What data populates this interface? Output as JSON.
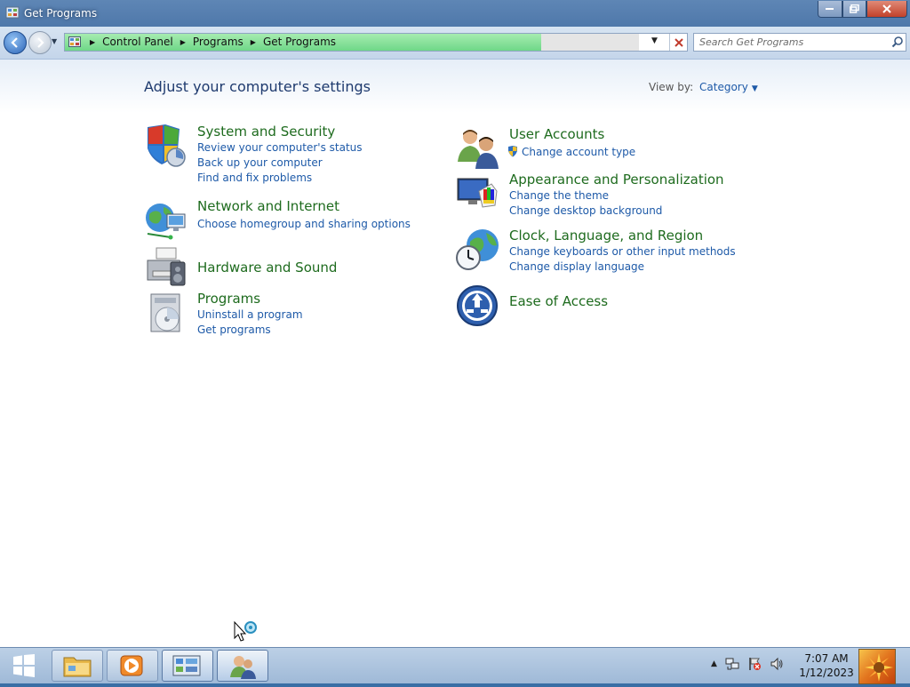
{
  "window": {
    "title": "Get Programs"
  },
  "navigation": {
    "breadcrumbs": [
      "Control Panel",
      "Programs",
      "Get Programs"
    ],
    "search_placeholder": "Search Get Programs"
  },
  "content": {
    "heading": "Adjust your computer's settings",
    "view_by_label": "View by:",
    "view_by_value": "Category",
    "categories_left": [
      {
        "title": "System and Security",
        "icon": "shield-icon",
        "links": [
          "Review your computer's status",
          "Back up your computer",
          "Find and fix problems"
        ]
      },
      {
        "title": "Network and Internet",
        "icon": "globe-network-icon",
        "links": [
          "Choose homegroup and sharing options"
        ]
      },
      {
        "title": "Hardware and Sound",
        "icon": "printer-speaker-icon",
        "links": []
      },
      {
        "title": "Programs",
        "icon": "programs-disc-icon",
        "links": [
          "Uninstall a program",
          "Get programs"
        ]
      }
    ],
    "categories_right": [
      {
        "title": "User Accounts",
        "icon": "users-icon",
        "links": [
          "Change account type"
        ]
      },
      {
        "title": "Appearance and Personalization",
        "icon": "monitor-palette-icon",
        "links": [
          "Change the theme",
          "Change desktop background"
        ]
      },
      {
        "title": "Clock, Language, and Region",
        "icon": "clock-globe-icon",
        "links": [
          "Change keyboards or other input methods",
          "Change display language"
        ]
      },
      {
        "title": "Ease of Access",
        "icon": "ease-of-access-icon",
        "links": []
      }
    ]
  },
  "taskbar": {
    "time": "7:07 AM",
    "date": "1/12/2023",
    "pinned": [
      "file-explorer-icon",
      "media-player-icon",
      "control-panel-icon",
      "user-accounts-icon"
    ]
  },
  "colors": {
    "category_title": "#1e6b1e",
    "link": "#1e5aa8",
    "heading": "#1e3a6e",
    "progress": "#6fd788"
  }
}
